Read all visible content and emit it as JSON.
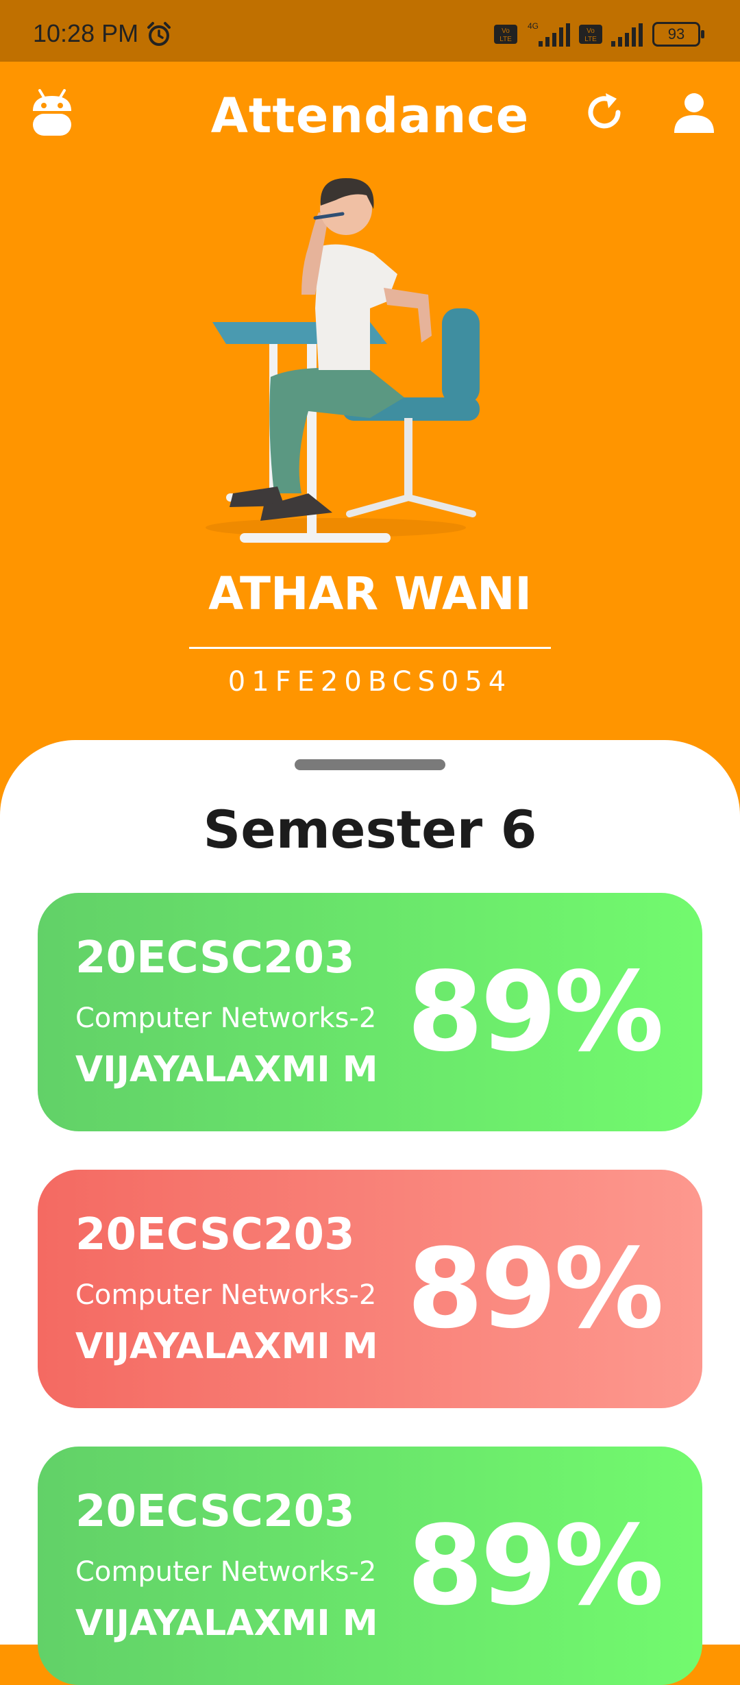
{
  "status_bar": {
    "time": "10:28 PM",
    "battery": "93",
    "icons": [
      "alarm-icon",
      "volte-icon",
      "signal-icon",
      "battery-icon"
    ]
  },
  "header": {
    "title": "Attendance",
    "icons": [
      "android-logo-icon",
      "refresh-icon",
      "profile-icon"
    ]
  },
  "student": {
    "name": "ATHAR WANI",
    "id": "01FE20BCS054"
  },
  "semester": {
    "title": "Semester 6"
  },
  "courses": [
    {
      "code": "20ECSC203",
      "subject": "Computer Networks-2",
      "teacher": "VIJAYALAXMI M",
      "percent": "89%",
      "status": "good"
    },
    {
      "code": "20ECSC203",
      "subject": "Computer Networks-2",
      "teacher": "VIJAYALAXMI M",
      "percent": "89%",
      "status": "low"
    },
    {
      "code": "20ECSC203",
      "subject": "Computer Networks-2",
      "teacher": "VIJAYALAXMI M",
      "percent": "89%",
      "status": "good"
    }
  ],
  "colors": {
    "primary": "#ff9500",
    "status_bar": "#c07000",
    "good_gradient": [
      "#62d168",
      "#72fa6e"
    ],
    "low_gradient": [
      "#f46a62",
      "#fd988e"
    ]
  }
}
